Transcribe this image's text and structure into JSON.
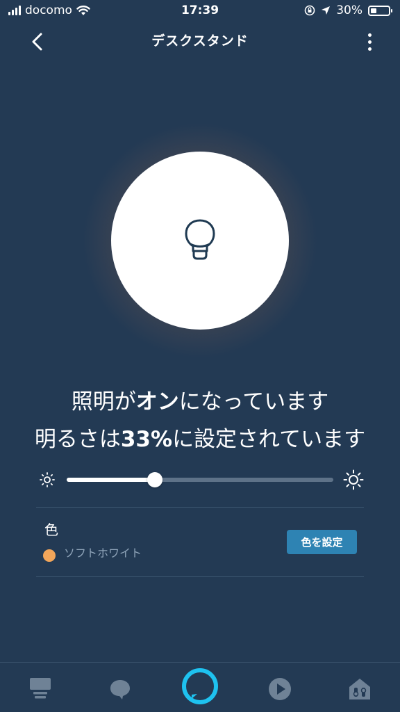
{
  "status_bar": {
    "carrier": "docomo",
    "time": "17:39",
    "battery": "30%"
  },
  "header": {
    "title": "デスクスタンド",
    "back_icon": "chevron-left-icon",
    "more_icon": "more-vertical-icon"
  },
  "light": {
    "icon": "lightbulb-icon",
    "glow_color": "#f5b870"
  },
  "status": {
    "line1_pre": "照明が",
    "line1_bold": "オン",
    "line1_post": "になっています",
    "line2_pre": "明るさは",
    "line2_bold": "33%",
    "line2_post": "に設定されています"
  },
  "brightness": {
    "value_percent": 33
  },
  "color_section": {
    "label": "色",
    "current_color_name": "ソフトホワイト",
    "current_color_hex": "#f2a65a",
    "set_button_label": "色を設定"
  },
  "bottom_nav": {
    "items": [
      {
        "icon": "home-icon"
      },
      {
        "icon": "communicate-icon"
      },
      {
        "icon": "alexa-icon"
      },
      {
        "icon": "play-icon"
      },
      {
        "icon": "devices-icon"
      }
    ]
  },
  "colors": {
    "background": "#233a54",
    "accent_button": "#2e83b3",
    "alexa_ring": "#1ec2f0"
  }
}
